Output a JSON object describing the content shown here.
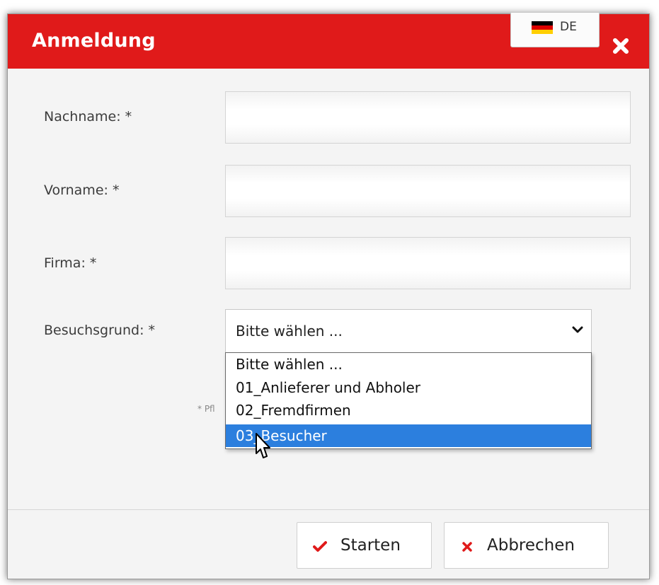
{
  "dialog": {
    "title": "Anmeldung",
    "language": {
      "label": "DE",
      "flag_colors": [
        "#000000",
        "#dd0000",
        "#ffce00"
      ]
    },
    "close_icon": "close-icon"
  },
  "form": {
    "fields": [
      {
        "label": "Nachname: *",
        "value": ""
      },
      {
        "label": "Vorname: *",
        "value": ""
      },
      {
        "label": "Firma: *",
        "value": ""
      }
    ],
    "visit_reason": {
      "label": "Besuchsgrund: *",
      "selected": "Bitte wählen ...",
      "options": [
        "Bitte wählen ...",
        "01_Anlieferer und Abholer",
        "02_Fremdfirmen",
        "03_Besucher"
      ],
      "highlighted_index": 3
    },
    "required_hint": "* Pfl"
  },
  "footer": {
    "start_label": "Starten",
    "cancel_label": "Abbrechen"
  },
  "colors": {
    "header": "#e01a1a",
    "highlight": "#2c7fde",
    "check": "#e01a1a",
    "cancel_x": "#e01a1a"
  }
}
